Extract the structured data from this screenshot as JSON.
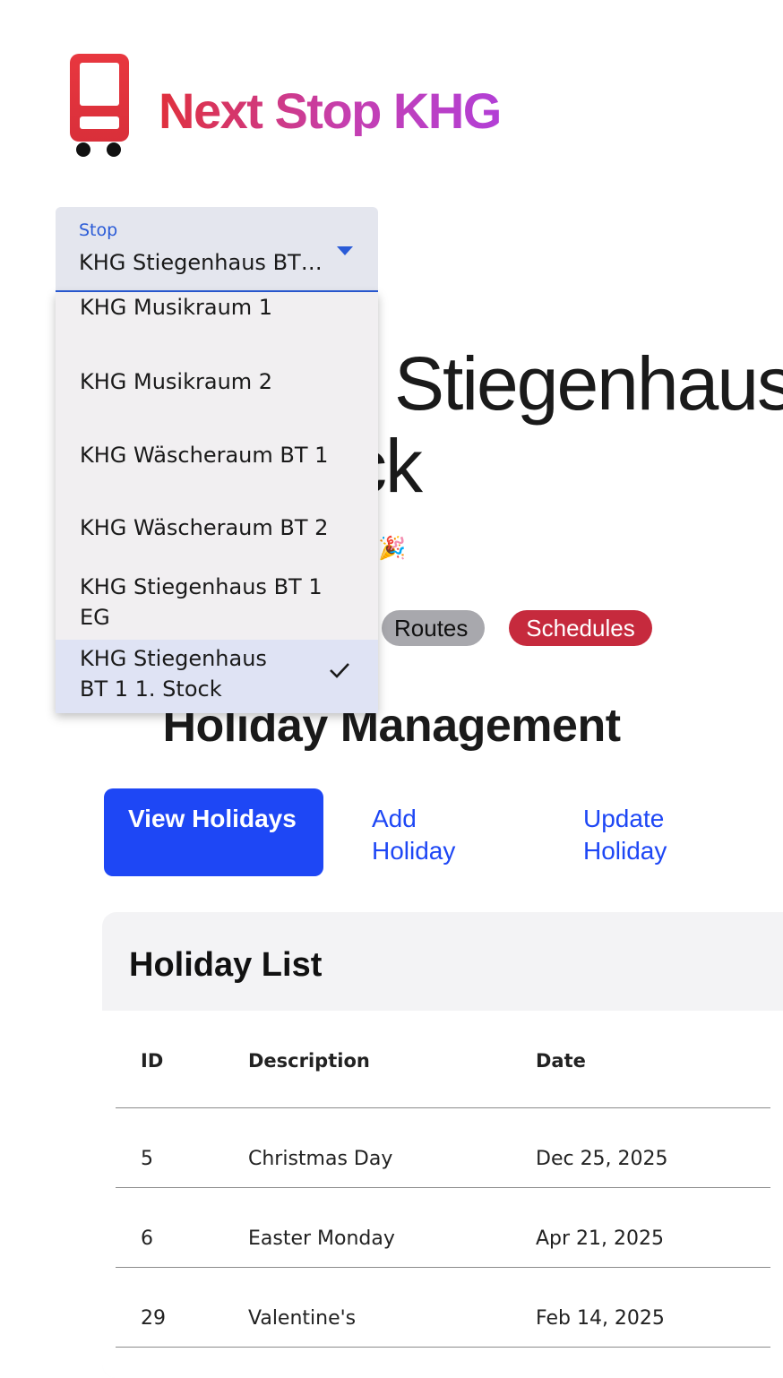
{
  "app": {
    "title": "Next Stop KHG"
  },
  "stop": {
    "heading_visible": "Stiegenhaus",
    "heading_line2": "ck",
    "event_text": "HG Event! 🎉",
    "tags": {
      "routes": "Routes",
      "schedules": "Schedules"
    }
  },
  "section": {
    "title": "Holiday Management"
  },
  "tabs": {
    "view": "View Holidays",
    "add": "Add Holiday",
    "update": "Update Holiday"
  },
  "holiday_list": {
    "title": "Holiday List",
    "columns": [
      "ID",
      "Description",
      "Date"
    ],
    "rows": [
      {
        "id": "5",
        "description": "Christmas Day",
        "date": "Dec 25, 2025"
      },
      {
        "id": "6",
        "description": "Easter Monday",
        "date": "Apr 21, 2025"
      },
      {
        "id": "29",
        "description": "Valentine's",
        "date": "Feb 14, 2025"
      }
    ]
  },
  "stop_select": {
    "label": "Stop",
    "value": "KHG Stiegenhaus BT…",
    "options": [
      "KHG Musikraum 1",
      "KHG Musikraum 2",
      "KHG Wäscheraum BT 1",
      "KHG Wäscheraum BT 2",
      "KHG Stiegenhaus BT 1 EG",
      "KHG Stiegenhaus BT 1 1. Stock"
    ],
    "options_display": [
      [
        "KHG Musikraum 1"
      ],
      [
        "KHG Musikraum 2"
      ],
      [
        "KHG Wäscheraum BT 1"
      ],
      [
        "KHG Wäscheraum BT 2"
      ],
      [
        "KHG Stiegenhaus BT 1",
        "EG"
      ],
      [
        "KHG Stiegenhaus",
        "BT 1 1. Stock"
      ]
    ],
    "selected_index": 5
  },
  "colors": {
    "accent": "#1e47f5",
    "brand_red": "#e0303c",
    "brand_purple": "#b23fd6",
    "select_blue": "#2a5bd7",
    "schedules_pill": "#c62a3d",
    "routes_pill": "#a8a8ad"
  },
  "icons": {
    "logo": "bus-stop-icon",
    "check": "check-icon",
    "caret": "caret-down-icon"
  }
}
